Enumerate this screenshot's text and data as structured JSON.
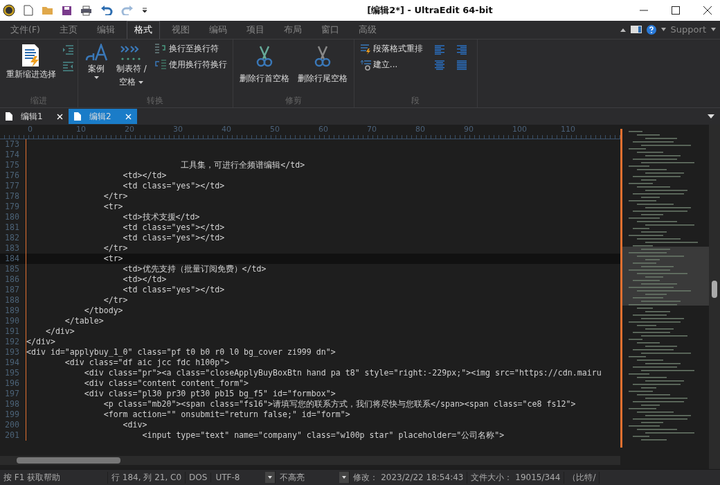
{
  "title_bar": {
    "title": "[编辑2*] - UltraEdit 64-bit"
  },
  "menu_tabs": [
    {
      "label": "文件(F)",
      "selected": false
    },
    {
      "label": "主页",
      "selected": false
    },
    {
      "label": "编辑",
      "selected": false
    },
    {
      "label": "格式",
      "selected": true
    },
    {
      "label": "视图",
      "selected": false
    },
    {
      "label": "编码",
      "selected": false
    },
    {
      "label": "项目",
      "selected": false
    },
    {
      "label": "布局",
      "selected": false
    },
    {
      "label": "窗口",
      "selected": false
    },
    {
      "label": "高级",
      "selected": false
    }
  ],
  "support": "Support",
  "ribbon_groups": [
    {
      "label": "缩进",
      "buttons": [
        "重新缩进选择"
      ]
    },
    {
      "label": "转换",
      "buttons": [
        "案例",
        "制表符 /",
        "空格",
        "换行至换行符",
        "使用换行符换行"
      ]
    },
    {
      "label": "修剪",
      "buttons": [
        "删除行首空格",
        "删除行尾空格"
      ]
    },
    {
      "label": "段",
      "buttons": [
        "段落格式重排",
        "建立..."
      ]
    }
  ],
  "doc_tabs": [
    {
      "label": "编辑1",
      "selected": false
    },
    {
      "label": "编辑2",
      "selected": true
    }
  ],
  "ruler": [
    "0",
    "10",
    "20",
    "30",
    "40",
    "50",
    "60",
    "70",
    "80",
    "90",
    "100",
    "110"
  ],
  "code_lines": [
    {
      "n": "173",
      "current": false
    },
    {
      "n": "174",
      "current": false
    },
    {
      "n": "175",
      "text": "                                工具集，可进行全频谱编辑</td>",
      "current": false
    },
    {
      "n": "176",
      "text": "                    <td></td>",
      "current": false
    },
    {
      "n": "177",
      "text": "                    <td class=\"yes\"></td>",
      "current": false
    },
    {
      "n": "178",
      "text": "                </tr>",
      "current": false
    },
    {
      "n": "179",
      "text": "                <tr>",
      "current": false
    },
    {
      "n": "180",
      "text": "                    <td>技术支援</td>",
      "current": false
    },
    {
      "n": "181",
      "text": "                    <td class=\"yes\"></td>",
      "current": false
    },
    {
      "n": "182",
      "text": "                    <td class=\"yes\"></td>",
      "current": false
    },
    {
      "n": "183",
      "text": "                </tr>",
      "current": false
    },
    {
      "n": "184",
      "text": "                <tr>",
      "current": true
    },
    {
      "n": "185",
      "text": "                    <td>优先支持（批量订阅免费）</td>",
      "current": false
    },
    {
      "n": "186",
      "text": "                    <td></td>",
      "current": false
    },
    {
      "n": "187",
      "text": "                    <td class=\"yes\"></td>",
      "current": false
    },
    {
      "n": "188",
      "text": "                </tr>",
      "current": false
    },
    {
      "n": "189",
      "text": "            </tbody>",
      "current": false
    },
    {
      "n": "190",
      "text": "        </table>",
      "current": false
    },
    {
      "n": "191",
      "text": "    </div>",
      "current": false
    },
    {
      "n": "192",
      "text": "</div>",
      "current": false
    },
    {
      "n": "193",
      "text": "<div id=\"applybuy_1_0\" class=\"pf t0 b0 r0 l0 bg_cover zi999 dn\">",
      "current": false
    },
    {
      "n": "194",
      "text": "        <div class=\"df aic jcc fdc h100p\">",
      "current": false
    },
    {
      "n": "195",
      "text": "            <div class=\"pr\"><a class=\"closeApplyBuyBoxBtn hand pa t8\" style=\"right:-229px;\"><img src=\"https://cdn.mairu",
      "current": false
    },
    {
      "n": "196",
      "text": "            <div class=\"content content_form\">",
      "current": false
    },
    {
      "n": "197",
      "text": "            <div class=\"pl30 pr30 pt30 pb15 bg_f5\" id=\"formbox\">",
      "current": false
    },
    {
      "n": "198",
      "text": "                <p class=\"mb20\"><span class=\"fs16\">请填写您的联系方式，我们将尽快与您联系</span><span class=\"ce8 fs12\">",
      "current": false
    },
    {
      "n": "199",
      "text": "                <form action=\"\" onsubmit=\"return false;\" id=\"form\">",
      "current": false
    },
    {
      "n": "200",
      "text": "                    <div>",
      "current": false
    },
    {
      "n": "201",
      "text": "                        <input type=\"text\" name=\"company\" class=\"w100p star\" placeholder=\"公司名称\">",
      "current": false
    }
  ],
  "status_bar": {
    "help": "按 F1 获取帮助",
    "position": "行 184, 列 21, C0",
    "line_ending": "DOS",
    "encoding": "UTF-8",
    "highlight": "不高亮",
    "modified": "修改：  2023/2/22 18:54:43",
    "file_size": "文件大小：  19015/344",
    "tail": "（比特/"
  }
}
